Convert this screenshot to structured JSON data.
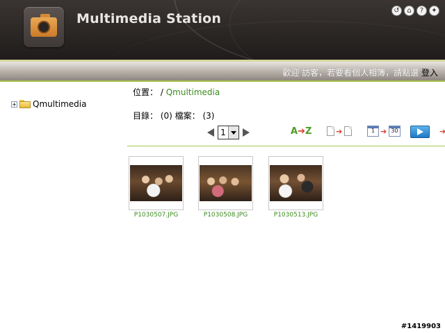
{
  "header": {
    "title": "Multimedia Station",
    "icons": [
      "back-icon",
      "home-icon",
      "help-icon",
      "settings-icon"
    ]
  },
  "welcome_bar": {
    "text": "歡迎 訪客，若要看個人相簿，請點選 ",
    "login_label": "登入"
  },
  "tree": {
    "root_label": "Qmultimedia"
  },
  "location": {
    "label": "位置：",
    "separator": "/",
    "path": "Qmultimedia"
  },
  "counts": {
    "text": "目錄： (0) 檔案： (3)"
  },
  "pager": {
    "current_page": "1"
  },
  "toolbar": {
    "sort_az_left": "A",
    "sort_az_arrow": "➔",
    "sort_az_right": "Z",
    "cal_start": "1",
    "cal_end": "30",
    "arrow_glyph": "➔"
  },
  "thumbnails": [
    {
      "filename": "P1030507.JPG"
    },
    {
      "filename": "P1030508.JPG"
    },
    {
      "filename": "P1030513.JPG"
    }
  ],
  "watermark": "#1419903",
  "colors": {
    "accent_green": "#3a8a1e",
    "band_border": "#a8c34e",
    "arrow_red": "#d93a2a"
  }
}
